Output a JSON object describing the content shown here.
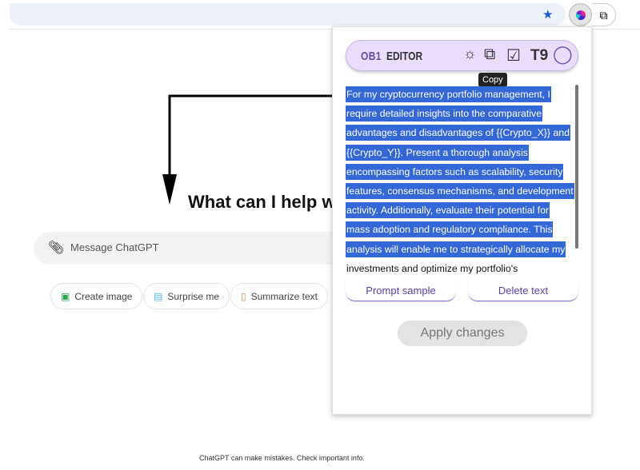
{
  "browser": {
    "bookmark_icon": "star-icon",
    "extension_icon": "ob1-extension-icon",
    "extensions_icon": "puzzle-icon"
  },
  "chat": {
    "heading": "What can I help with?",
    "message_placeholder": "Message ChatGPT",
    "chips": [
      {
        "label": "Create image",
        "icon": "image-icon",
        "color": "#22a745"
      },
      {
        "label": "Surprise me",
        "icon": "gift-icon",
        "color": "#5bbbe8"
      },
      {
        "label": "Summarize text",
        "icon": "document-icon",
        "color": "#e88a4a"
      }
    ],
    "footer": "ChatGPT can make mistakes. Check important info."
  },
  "popup": {
    "logo_a": "OB1",
    "logo_b": "EDITOR",
    "tone_label": "T9",
    "tooltip": "Copy",
    "text_lines": [
      "For my cryptocurrency portfolio management, I",
      "require detailed insights into the comparative",
      "advantages and disadvantages of {{Crypto_X}} and",
      "{{Crypto_Y}}. Present a thorough analysis",
      "encompassing factors such as scalability, security",
      "features, consensus mechanisms, and development",
      "activity. Additionally, evaluate their potential for",
      "mass adoption and regulatory compliance. This",
      "analysis will enable me to strategically allocate my",
      "investments and optimize my portfolio's"
    ],
    "prompt_sample": "Prompt sample",
    "delete_text": "Delete text",
    "apply": "Apply changes",
    "accent": "#6a4aa8",
    "selection_color": "#3468d6"
  }
}
